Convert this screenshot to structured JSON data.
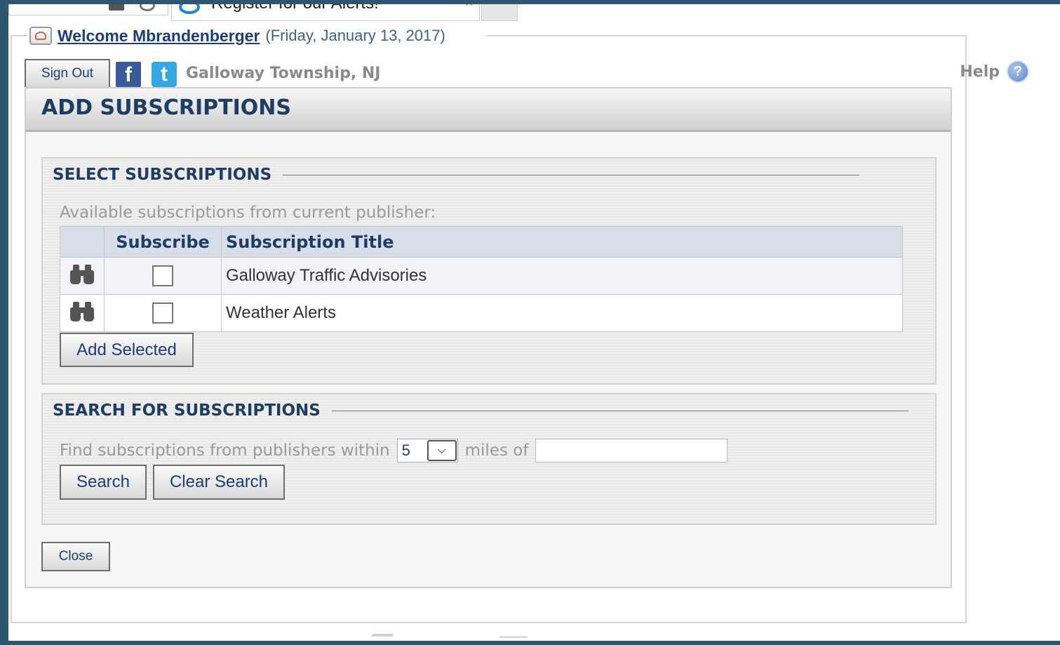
{
  "browser": {
    "tab_title": "Register for our Alerts!",
    "tab_close": "×"
  },
  "header": {
    "welcome": "Welcome Mbrandenberger",
    "date": "(Friday, January 13, 2017)",
    "sign_out": "Sign Out",
    "facebook_glyph": "f",
    "twitter_glyph": "t",
    "publisher": "Galloway Township, NJ",
    "help": "Help",
    "help_glyph": "?"
  },
  "panel": {
    "title": "ADD SUBSCRIPTIONS"
  },
  "select_section": {
    "title": "SELECT SUBSCRIPTIONS",
    "hint": "Available subscriptions from current publisher:",
    "columns": [
      "",
      "Subscribe",
      "Subscription Title"
    ],
    "rows": [
      {
        "title": "Galloway Traffic Advisories",
        "checked": false
      },
      {
        "title": "Weather Alerts",
        "checked": false
      }
    ],
    "add_button": "Add Selected"
  },
  "search_section": {
    "title": "SEARCH FOR SUBSCRIPTIONS",
    "find_label": "Find subscriptions from publishers within",
    "miles_value": "5",
    "miles_of_label": "miles of",
    "location_value": "",
    "search_button": "Search",
    "clear_button": "Clear Search"
  },
  "close_button": "Close",
  "colors": {
    "accent_text": "#1f3c62",
    "link": "#1c3d7a",
    "background": "#2f566f"
  }
}
